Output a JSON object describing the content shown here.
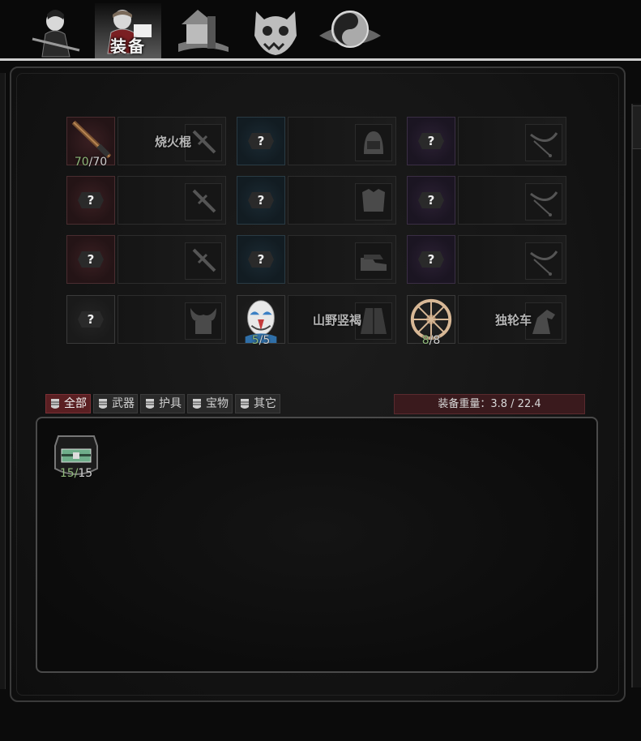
{
  "tabs": [
    {
      "id": "character",
      "label": ""
    },
    {
      "id": "equipment",
      "label": "装备",
      "active": true
    },
    {
      "id": "building",
      "label": ""
    },
    {
      "id": "beast",
      "label": ""
    },
    {
      "id": "taiji",
      "label": ""
    }
  ],
  "equipment": {
    "rows": [
      [
        {
          "color": "red",
          "unknown": false,
          "count": "70",
          "max": "70",
          "name": "烧火棍",
          "icon": "sword-icon"
        },
        {
          "color": "blue",
          "unknown": true,
          "count": "",
          "max": "",
          "name": "",
          "icon": "helmet-icon"
        },
        {
          "color": "purple",
          "unknown": true,
          "count": "",
          "max": "",
          "name": "",
          "icon": "whip-icon"
        }
      ],
      [
        {
          "color": "red",
          "unknown": true,
          "count": "",
          "max": "",
          "name": "",
          "icon": "sword-icon"
        },
        {
          "color": "blue",
          "unknown": true,
          "count": "",
          "max": "",
          "name": "",
          "icon": "armor-icon"
        },
        {
          "color": "purple",
          "unknown": true,
          "count": "",
          "max": "",
          "name": "",
          "icon": "whip-icon"
        }
      ],
      [
        {
          "color": "red",
          "unknown": true,
          "count": "",
          "max": "",
          "name": "",
          "icon": "sword-icon"
        },
        {
          "color": "blue",
          "unknown": true,
          "count": "",
          "max": "",
          "name": "",
          "icon": "boots-icon"
        },
        {
          "color": "purple",
          "unknown": true,
          "count": "",
          "max": "",
          "name": "",
          "icon": "whip-icon"
        }
      ],
      [
        {
          "color": "gray",
          "unknown": true,
          "count": "",
          "max": "",
          "name": "",
          "icon": "horned-helmet-icon"
        },
        {
          "color": "gray",
          "unknown": false,
          "count": "5",
          "max": "5",
          "name": "山野竖褐",
          "icon": "robe-icon",
          "item": "opera-mask-icon"
        },
        {
          "color": "gray",
          "unknown": false,
          "count": "8",
          "max": "8",
          "name": "独轮车",
          "icon": "horse-icon",
          "item": "wheel-icon"
        }
      ]
    ],
    "unknown_symbol": "?"
  },
  "filters": [
    {
      "label": "全部",
      "active": true,
      "icon": "all-icon"
    },
    {
      "label": "武器",
      "active": false,
      "icon": "weapon-icon"
    },
    {
      "label": "护具",
      "active": false,
      "icon": "armor-filter-icon"
    },
    {
      "label": "宝物",
      "active": false,
      "icon": "treasure-icon"
    },
    {
      "label": "其它",
      "active": false,
      "icon": "other-icon"
    }
  ],
  "weight": {
    "label": "装备重量：",
    "current": "3.8",
    "max": "22.4",
    "text": "装备重量：3.8 / 22.4"
  },
  "inventory": [
    {
      "icon": "chest-icon",
      "count": "15",
      "max": "15"
    }
  ],
  "colors": {
    "active": "#5a1f22",
    "count_green": "#8fb87a"
  }
}
